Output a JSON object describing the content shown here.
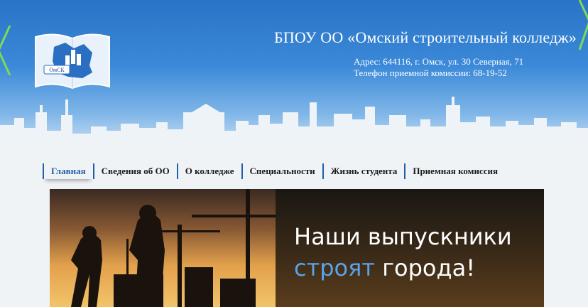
{
  "header": {
    "logo_text": "ОмСК",
    "title": "БПОУ ОО «Омский строительный колледж»",
    "address": "Адрес: 644116, г. Омск, ул. 30 Северная, 71",
    "phone": "Телефон приемной комиссии: 68-19-52"
  },
  "nav": {
    "items": [
      {
        "label": "Главная"
      },
      {
        "label": "Сведения об ОО"
      },
      {
        "label": "О колледже"
      },
      {
        "label": "Специальности"
      },
      {
        "label": "Жизнь студента"
      },
      {
        "label": "Приемная комиссия"
      }
    ],
    "active_index": 0
  },
  "banner": {
    "line1": "Наши выпускники",
    "line2_accent": "строят",
    "line2_rest": " города!"
  },
  "colors": {
    "header_blue": "#2a73c6",
    "nav_active": "#1f5fa8",
    "accent_text": "#5aa3e8"
  }
}
